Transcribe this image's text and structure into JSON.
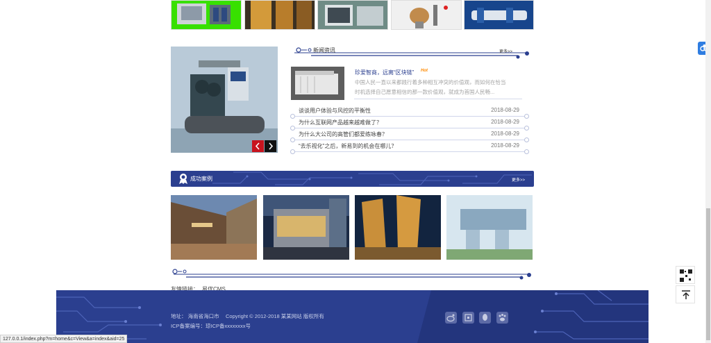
{
  "products": {
    "images": [
      "green-machine",
      "wood-frame-machine",
      "filter-machine",
      "lab-device",
      "blue-pump"
    ]
  },
  "news": {
    "section_title": "新闻资讯",
    "more": "更多>>",
    "featured": {
      "title": "珍爱智商，远离“区块链”",
      "badge": "Hot",
      "summary_line1": "中国人民一直以来都践行着多种相互冲突的价值观，而如何在恰当",
      "summary_line2": "时机选择自己愿意相信的那一款价值观，就成为首国人民畅..."
    },
    "items": [
      {
        "title": "谈谈用户体验与风控的平衡性",
        "date": "2018-08-29"
      },
      {
        "title": "为什么互联网产品越来越难做了？",
        "date": "2018-08-29"
      },
      {
        "title": "为什么大公司的高管们都爱练咏春？",
        "date": "2018-08-29"
      },
      {
        "title": "“去乐视化”之后，新易到的机会在哪儿？",
        "date": "2018-08-29"
      }
    ]
  },
  "cases": {
    "section_title": "成功案例",
    "more": "更多>>"
  },
  "links": {
    "label": "友情链接：",
    "items": [
      "易优CMS"
    ]
  },
  "footer": {
    "address": "地址：  海南省海口市",
    "copyright": "Copyright © 2012-2018 某某网站 版权所有",
    "icp": "ICP备案编号：琼ICP备xxxxxxxx号"
  },
  "status_bar": {
    "url": "127.0.0.1/index.php?m=home&c=View&a=index&aid=25"
  },
  "colors": {
    "brand_blue": "#2b3f8f",
    "accent_red": "#c8141e",
    "hot_orange": "#ff8a00",
    "share_blue": "#2f7de1"
  }
}
